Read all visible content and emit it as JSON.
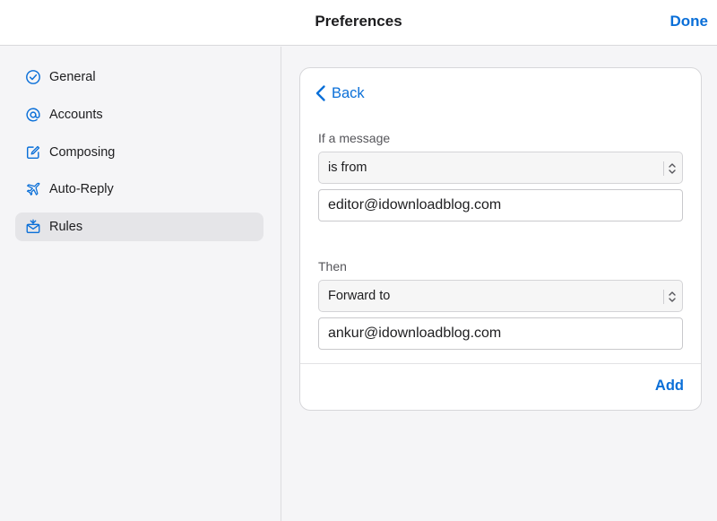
{
  "header": {
    "title": "Preferences",
    "done_label": "Done"
  },
  "sidebar": {
    "items": [
      {
        "label": "General",
        "icon": "checkmark-circle-icon",
        "selected": false
      },
      {
        "label": "Accounts",
        "icon": "at-sign-icon",
        "selected": false
      },
      {
        "label": "Composing",
        "icon": "compose-icon",
        "selected": false
      },
      {
        "label": "Auto-Reply",
        "icon": "airplane-icon",
        "selected": false
      },
      {
        "label": "Rules",
        "icon": "envelope-rules-icon",
        "selected": true
      }
    ]
  },
  "rule": {
    "back_label": "Back",
    "condition_label": "If a message",
    "condition_select": "is from",
    "condition_value": "editor@idownloadblog.com",
    "action_label": "Then",
    "action_select": "Forward to",
    "action_value": "ankur@idownloadblog.com",
    "add_label": "Add"
  },
  "colors": {
    "accent": "#0a6fd8",
    "selected_bg": "#e5e5e8"
  }
}
